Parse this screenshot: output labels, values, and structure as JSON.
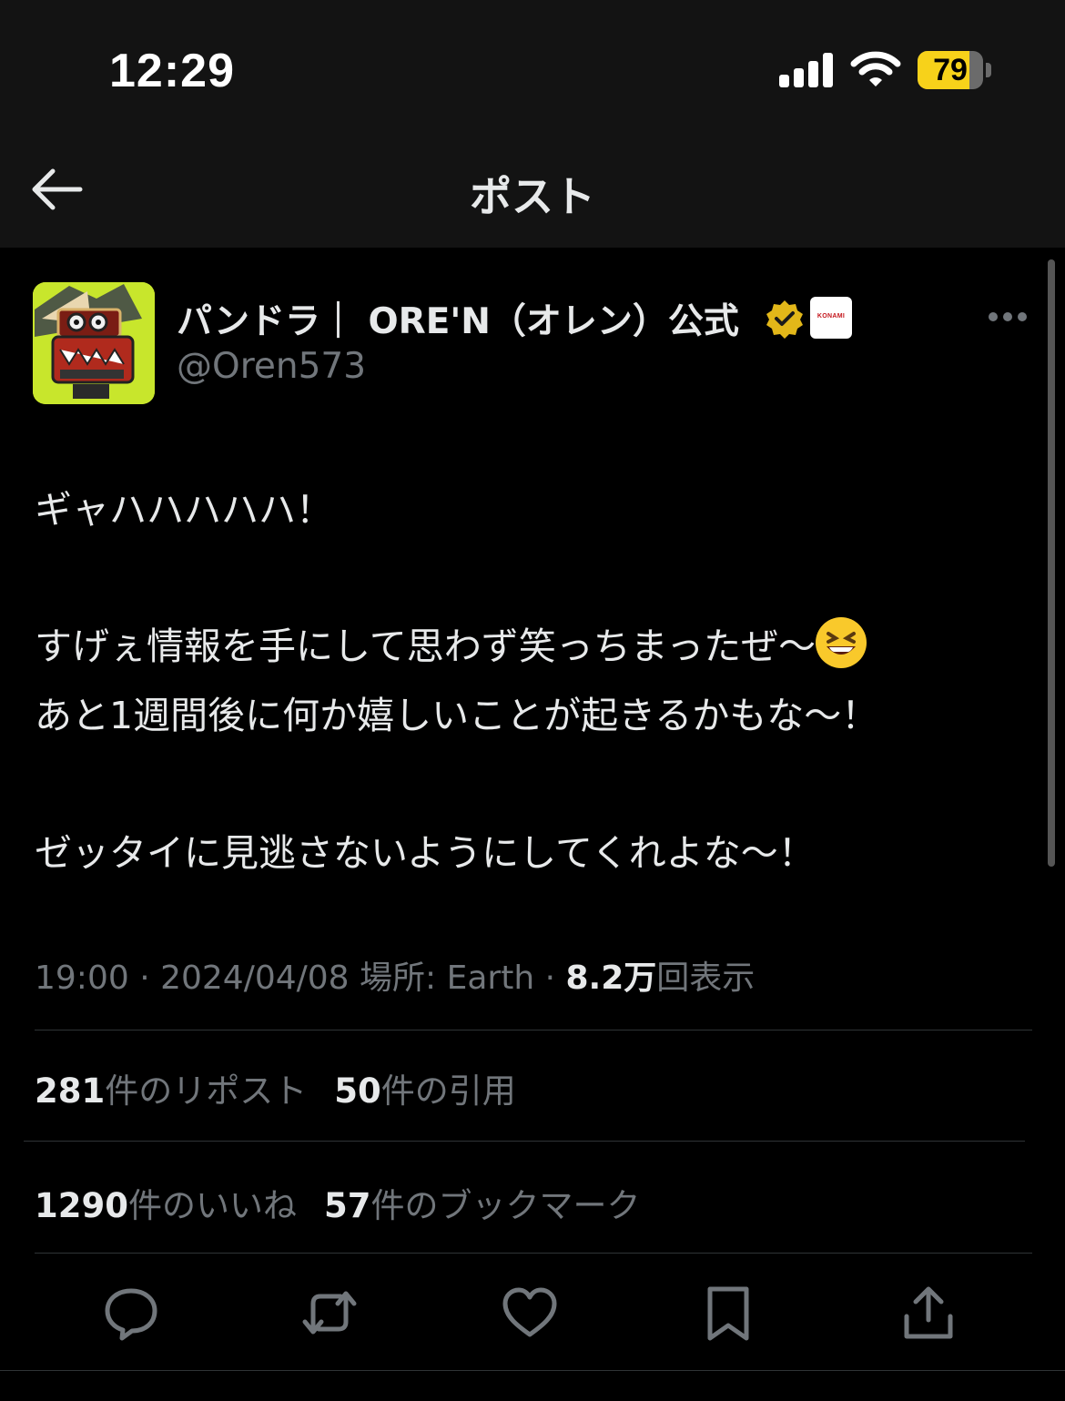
{
  "status_bar": {
    "time": "12:29",
    "battery_percent": "79",
    "battery_level": 0.79
  },
  "nav": {
    "title": "ポスト",
    "back_icon": "arrow-left-icon"
  },
  "post": {
    "author_name": "パンドラ｜ ORE'N（オレン）公式",
    "handle": "@Oren573",
    "affiliation_badge": "KONAMI",
    "text_lines": [
      "ギャハハハハハ！",
      "すげぇ情報を手にして思わず笑っちまったぜ〜",
      "あと1週間後に何か嬉しいことが起きるかもな〜！",
      "ゼッタイに見逃さないようにしてくれよな〜！"
    ],
    "meta": {
      "time": "19:00",
      "sep1": " · ",
      "date": "2024/04/08",
      "location": " 場所: Earth",
      "sep2": " · ",
      "views_count": "8.2万",
      "views_label": "回表示"
    },
    "stats": {
      "reposts_count": "281",
      "reposts_label": "件のリポスト",
      "quotes_count": "50",
      "quotes_label": "件の引用",
      "likes_count": "1290",
      "likes_label": "件のいいね",
      "bookmarks_count": "57",
      "bookmarks_label": "件のブックマーク"
    }
  },
  "actions": [
    "reply-icon",
    "repost-icon",
    "like-icon",
    "bookmark-icon",
    "share-icon"
  ],
  "colors": {
    "background": "#000000",
    "bar_background": "#131313",
    "text_primary": "#e7e9ea",
    "text_secondary": "#71767b",
    "divider": "#2f3336",
    "battery_fill": "#f7d21a",
    "verified_gold": "#e2b719"
  }
}
